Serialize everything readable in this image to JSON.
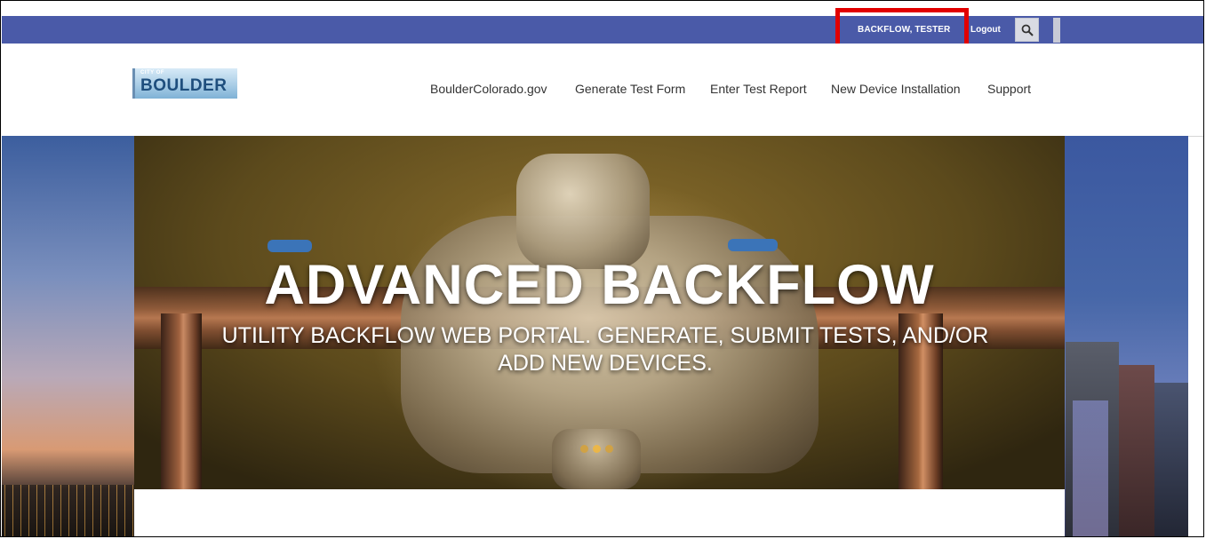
{
  "topbar": {
    "user_label": "BACKFLOW, TESTER",
    "logout_label": "Logout",
    "search_icon": "search-icon"
  },
  "annotation": {
    "highlight_color": "#e20000"
  },
  "header": {
    "logo_small": "CITY OF",
    "logo_main": "BOULDER",
    "nav": [
      "BoulderColorado.gov",
      "Generate Test Form",
      "Enter Test Report",
      "New Device Installation",
      "Support"
    ]
  },
  "hero": {
    "title": "ADVANCED BACKFLOW",
    "subtitle": "UTILITY BACKFLOW WEB PORTAL. GENERATE, SUBMIT TESTS, AND/OR ADD NEW DEVICES.",
    "slide_count": 3,
    "active_slide": 2
  },
  "colors": {
    "topbar": "#4a5aa8",
    "brand_blue": "#1e4e7d"
  }
}
